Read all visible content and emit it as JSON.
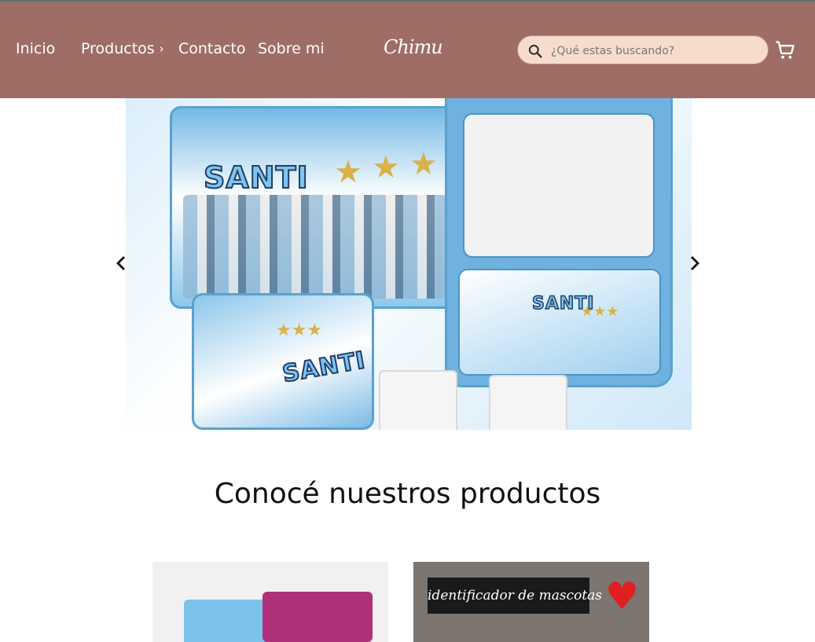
{
  "nav": {
    "inicio": "Inicio",
    "productos": "Productos",
    "contacto": "Contacto",
    "sobre_mi": "Sobre mi"
  },
  "logo_text": "Chimu",
  "search": {
    "placeholder": "¿Qué estas buscando?",
    "value": ""
  },
  "carousel": {
    "slide_texts": {
      "santi_main": "SANTI",
      "santi_small": "SANTI",
      "santi_towel": "SANTI"
    }
  },
  "products_section": {
    "title": "Conocé nuestros productos",
    "cards": [
      {
        "label": ""
      },
      {
        "label": "identificador de mascotas"
      }
    ]
  },
  "colors": {
    "header": "#9e6d66",
    "search_bg": "#f7dccd",
    "accent_blue": "#5ba1cf"
  },
  "icons": [
    "search-icon",
    "cart-icon",
    "chevron-right-icon",
    "arrow-left-icon",
    "arrow-right-icon"
  ]
}
